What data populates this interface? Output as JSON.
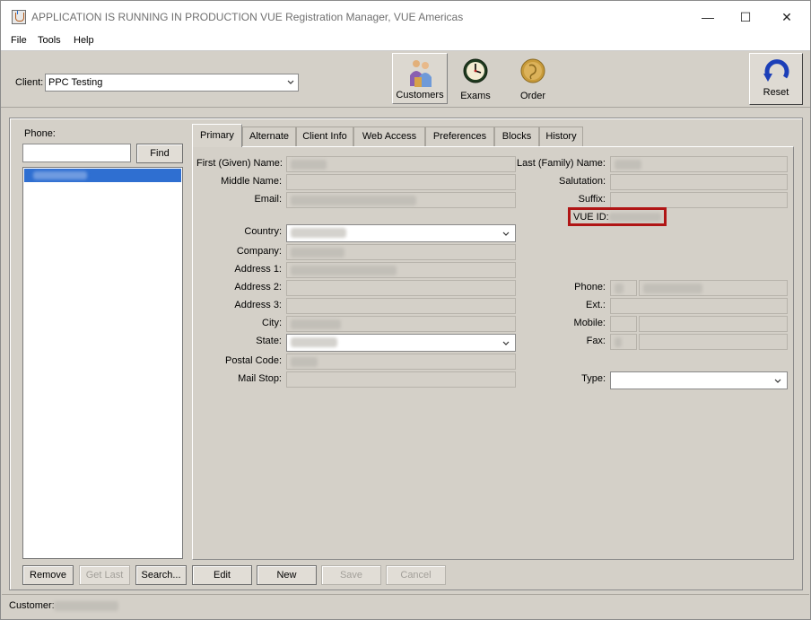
{
  "window": {
    "title": "APPLICATION IS RUNNING IN PRODUCTION  VUE Registration Manager, VUE Americas",
    "minimize_glyph": "—",
    "maximize_glyph": "☐",
    "close_glyph": "✕"
  },
  "menu": {
    "items": [
      "File",
      "Tools",
      "Help"
    ]
  },
  "toolbar": {
    "client_label": "Client:",
    "client_value": "PPC Testing",
    "buttons": [
      {
        "label": "Customers",
        "icon": "customers-icon"
      },
      {
        "label": "Exams",
        "icon": "clock-icon"
      },
      {
        "label": "Order",
        "icon": "coin-icon"
      }
    ],
    "reset_label": "Reset"
  },
  "search": {
    "phone_label": "Phone:",
    "find_label": "Find"
  },
  "tabs": [
    "Primary",
    "Alternate",
    "Client Info",
    "Web Access",
    "Preferences",
    "Blocks",
    "History"
  ],
  "form": {
    "first_name_label": "First (Given) Name:",
    "middle_name_label": "Middle Name:",
    "email_label": "Email:",
    "country_label": "Country:",
    "company_label": "Company:",
    "address1_label": "Address 1:",
    "address2_label": "Address 2:",
    "address3_label": "Address 3:",
    "city_label": "City:",
    "state_label": "State:",
    "postal_label": "Postal Code:",
    "mailstop_label": "Mail Stop:",
    "last_name_label": "Last (Family) Name:",
    "salutation_label": "Salutation:",
    "suffix_label": "Suffix:",
    "vueid_label": "VUE ID:",
    "phone_label": "Phone:",
    "ext_label": "Ext.:",
    "mobile_label": "Mobile:",
    "fax_label": "Fax:",
    "type_label": "Type:"
  },
  "bottom_buttons": {
    "remove": "Remove",
    "get_last": "Get Last",
    "search": "Search...",
    "edit": "Edit",
    "new": "New",
    "save": "Save",
    "cancel": "Cancel"
  },
  "status": {
    "customer_label": "Customer:"
  },
  "colors": {
    "background": "#d4d0c8",
    "selection": "#2f6fd1",
    "highlight_box": "#b01515"
  }
}
